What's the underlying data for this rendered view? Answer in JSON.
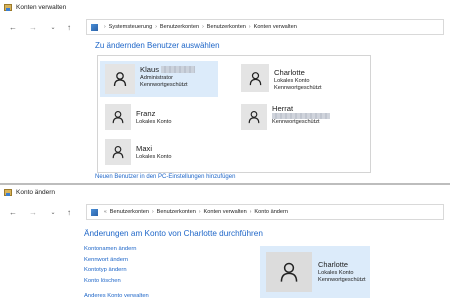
{
  "top": {
    "title": "Konten verwalten",
    "breadcrumb": [
      "Systemsteuerung",
      "Benutzerkonten",
      "Benutzerkonten",
      "Konten verwalten"
    ],
    "heading": "Zu ändernden Benutzer auswählen",
    "users": [
      {
        "name": "Klaus",
        "lines": [
          "Administrator",
          "Kennwortgeschützt"
        ],
        "selected": true,
        "redacted": true
      },
      {
        "name": "Charlotte",
        "lines": [
          "Lokales Konto",
          "Kennwortgeschützt"
        ],
        "selected": false,
        "redacted": false
      },
      {
        "name": "Franz",
        "lines": [
          "Lokales Konto"
        ],
        "selected": false,
        "redacted": false
      },
      {
        "name": "Herrat",
        "lines": [
          "Kennwortgeschützt"
        ],
        "selected": false,
        "redacted": true
      },
      {
        "name": "Maxi",
        "lines": [
          "Lokales Konto"
        ],
        "selected": false,
        "redacted": false
      }
    ],
    "add_user_link": "Neuen Benutzer in den PC-Einstellungen hinzufügen"
  },
  "bottom": {
    "title": "Konto ändern",
    "breadcrumb": [
      "Benutzerkonten",
      "Benutzerkonten",
      "Konten verwalten",
      "Konto ändern"
    ],
    "heading": "Änderungen am Konto von Charlotte durchführen",
    "tasks": [
      "Kontonamen ändern",
      "Kennwort ändern",
      "Kontotyp ändern",
      "Konto löschen"
    ],
    "other_task": "Anderes Konto verwalten",
    "profile": {
      "name": "Charlotte",
      "lines": [
        "Lokales Konto",
        "Kennwortgeschützt"
      ]
    }
  },
  "icons": {
    "back": "arrow-left-icon",
    "forward": "arrow-right-icon",
    "recent": "chevron-down-icon",
    "up": "arrow-up-icon",
    "user": "user-silhouette-icon"
  },
  "colors": {
    "link": "#1e66c8",
    "selected": "#dcebfa",
    "avatar_bg": "#e4e4e4"
  }
}
